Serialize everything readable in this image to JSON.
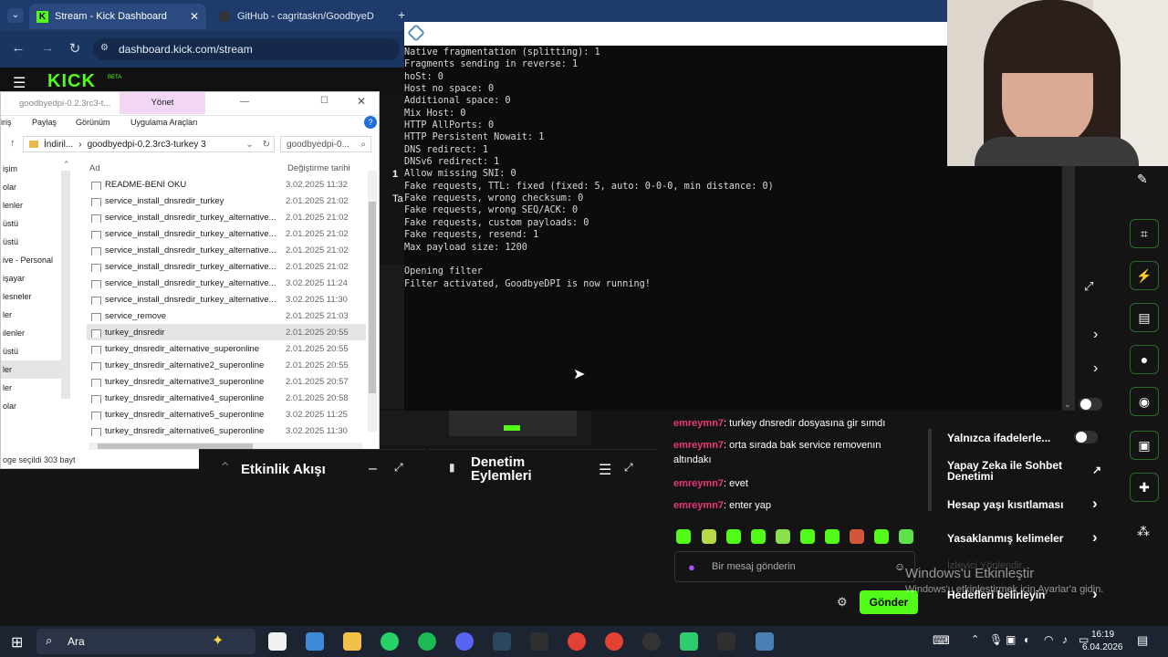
{
  "browser": {
    "tabs": [
      {
        "title": "Stream - Kick Dashboard"
      },
      {
        "title": "GitHub - cagritaskn/GoodbyeD"
      }
    ],
    "url": "dashboard.kick.com/stream"
  },
  "kick": {
    "logo": "KICK",
    "beta": "BETA"
  },
  "explorer": {
    "manage_tab": "Yönet",
    "ribbon": [
      "iriş",
      "Paylaş",
      "Görünüm",
      "Uygulama Araçları"
    ],
    "inactive_tab": "goodbyedpi-0.2.3rc3-t...",
    "path": [
      "İndiril...",
      "goodbyedpi-0.2.3rc3-turkey 3"
    ],
    "search_placeholder": "goodbyedpi-0...",
    "columns": {
      "name": "Ad",
      "date": "Değiştirme tarihi"
    },
    "nav_items": [
      "işim",
      "olar",
      "lenler",
      "üstü",
      "üstü",
      "ive - Personal",
      "işayar",
      "lesneler",
      "ler",
      "ilenler",
      "üstü",
      "ler",
      "ler",
      "olar"
    ],
    "files": [
      {
        "name": "README-BENİ OKU",
        "date": "3.02.2025 11:32"
      },
      {
        "name": "service_install_dnsredir_turkey",
        "date": "2.01.2025 21:02"
      },
      {
        "name": "service_install_dnsredir_turkey_alternative...",
        "date": "2.01.2025 21:02"
      },
      {
        "name": "service_install_dnsredir_turkey_alternative...",
        "date": "2.01.2025 21:02"
      },
      {
        "name": "service_install_dnsredir_turkey_alternative...",
        "date": "2.01.2025 21:02"
      },
      {
        "name": "service_install_dnsredir_turkey_alternative...",
        "date": "2.01.2025 21:02"
      },
      {
        "name": "service_install_dnsredir_turkey_alternative...",
        "date": "3.02.2025 11:24"
      },
      {
        "name": "service_install_dnsredir_turkey_alternative...",
        "date": "3.02.2025 11:30"
      },
      {
        "name": "service_remove",
        "date": "2.01.2025 21:03"
      },
      {
        "name": "turkey_dnsredir",
        "date": "2.01.2025 20:55",
        "selected": true
      },
      {
        "name": "turkey_dnsredir_alternative_superonline",
        "date": "2.01.2025 20:55"
      },
      {
        "name": "turkey_dnsredir_alternative2_superonline",
        "date": "2.01.2025 20:55"
      },
      {
        "name": "turkey_dnsredir_alternative3_superonline",
        "date": "2.01.2025 20:57"
      },
      {
        "name": "turkey_dnsredir_alternative4_superonline",
        "date": "2.01.2025 20:58"
      },
      {
        "name": "turkey_dnsredir_alternative5_superonline",
        "date": "3.02.2025 11:25"
      },
      {
        "name": "turkey_dnsredir_alternative6_superonline",
        "date": "3.02.2025 11:30"
      }
    ],
    "status": "oge seçildi  303 bayt"
  },
  "terminal": {
    "lines": [
      "Native fragmentation (splitting): 1",
      "Fragments sending in reverse: 1",
      "hoSt: 0",
      "Host no space: 0",
      "Additional space: 0",
      "Mix Host: 0",
      "HTTP AllPorts: 0",
      "HTTP Persistent Nowait: 1",
      "DNS redirect: 1",
      "DNSv6 redirect: 1",
      "Allow missing SNI: 0",
      "Fake requests, TTL: fixed (fixed: 5, auto: 0-0-0, min distance: 0)",
      "Fake requests, wrong checksum: 0",
      "Fake requests, wrong SEQ/ACK: 0",
      "Fake requests, custom payloads: 0",
      "Fake requests, resend: 1",
      "Max payload size: 1200",
      "",
      "Opening filter",
      "Filter activated, GoodbyeDPI is now running!"
    ]
  },
  "panels": {
    "activity": "Etkinlik Akışı",
    "moderation": "Denetim Eylemleri"
  },
  "chat": {
    "messages": [
      {
        "user": "emreymn7",
        "text": ": turkey dnsredir dosyasına gir sımdı"
      },
      {
        "user": "emreymn7",
        "text": ": orta sırada bak service removenın altındakı"
      },
      {
        "user": "emreymn7",
        "text": ": evet"
      },
      {
        "user": "emreymn7",
        "text": ": enter yap"
      }
    ],
    "input_placeholder": "Bir mesaj gönderin",
    "send_label": "Gönder"
  },
  "settings": {
    "items": [
      {
        "label": "Yalnızca ifadelerle..."
      },
      {
        "label": "Yapay Zeka ile Sohbet Denetimi"
      },
      {
        "label": "Hesap yaşı kısıtlaması"
      },
      {
        "label": "Yasaklanmış kelimeler"
      },
      {
        "label": "İzleyici Yönlendir..."
      },
      {
        "label": "Hedefleri belirleyin"
      }
    ]
  },
  "watermark": {
    "title": "Windows'u Etkinleştir",
    "subtitle": "Windows'u etkinleştirmek için Ayarlar'a gidin."
  },
  "side_numbers": [
    "1",
    "Ta"
  ],
  "taskbar": {
    "search": "Ara",
    "time": "16:19",
    "date": "6.04.2026"
  },
  "colors": {
    "kick_green": "#53fc18",
    "chat_user": "#e8367a"
  }
}
